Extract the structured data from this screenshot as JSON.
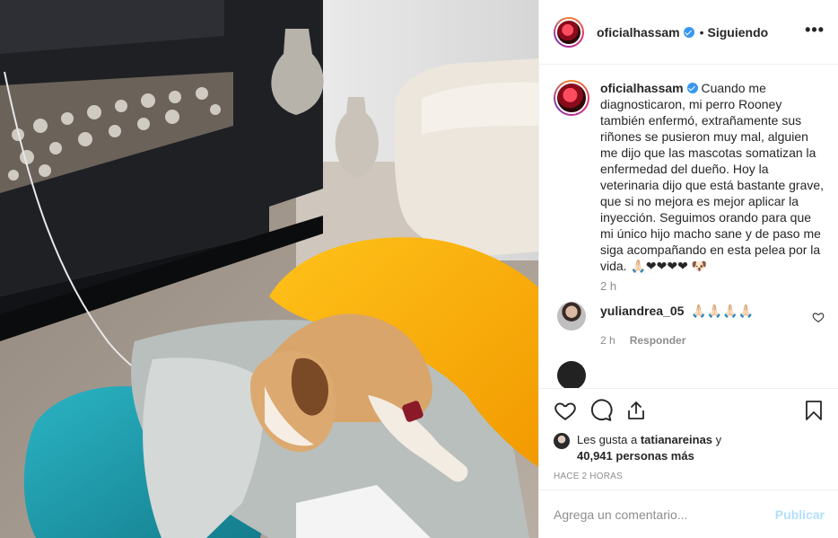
{
  "post": {
    "image_alt": "",
    "author": {
      "username": "oficialhassam",
      "verified": true
    },
    "header": {
      "separator": "•",
      "follow_state": "Siguiendo",
      "more_glyph": "•••"
    },
    "caption": {
      "username": "oficialhassam",
      "text": "Cuando me diagnosticaron, mi perro Rooney también enfermó, extrañamente sus riñones se pusieron muy mal, alguien me dijo que las mascotas somatizan la enfermedad del dueño. Hoy la veterinaria dijo que está bastante grave, que si no mejora es mejor aplicar la inyección. Seguimos orando para que mi único hijo macho sane y de paso me siga acompañando en esta pelea por la vida. 🙏🏻❤❤❤❤ 🐶",
      "time": "2 h"
    },
    "comments": [
      {
        "username": "yuliandrea_05",
        "text": "🙏🏻🙏🏻🙏🏻🙏🏻",
        "time": "2 h",
        "reply_label": "Responder"
      }
    ],
    "likes": {
      "prefix": "Les gusta a ",
      "first_user": "tatianareinas",
      "connector": " y",
      "others": "40,941 personas más"
    },
    "posted_ago": "HACE 2 HORAS",
    "add_comment": {
      "placeholder": "Agrega un comentario...",
      "submit_label": "Publicar"
    },
    "icons": [
      "heart-icon",
      "comment-icon",
      "share-icon",
      "bookmark-icon"
    ],
    "colors": {
      "verified": "#3897f0",
      "publish_disabled": "#b2dffc",
      "muted_text": "#8e8e8e"
    }
  }
}
